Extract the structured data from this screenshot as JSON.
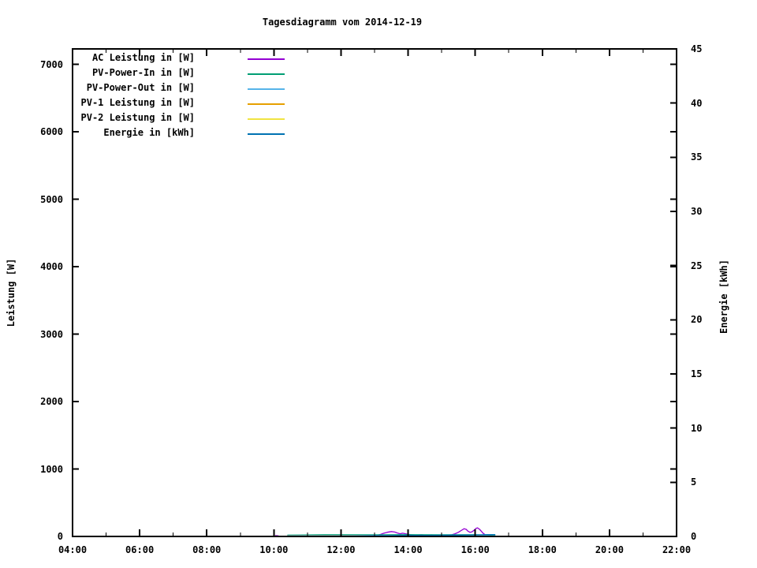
{
  "page": {
    "background": "#ffffff",
    "text_color": "#000000"
  },
  "chart_data": {
    "type": "line",
    "title": "Tagesdiagramm vom 2014-12-19",
    "xlabel": "",
    "ylabel": "Leistung [W]",
    "y2label": "Energie [kWh]",
    "x_range_hours": [
      4,
      22
    ],
    "ylim": [
      0,
      7230
    ],
    "y2lim": [
      0,
      45
    ],
    "grid": false,
    "legend_position": "top-left-inside",
    "x_major_ticks": [
      {
        "hour": 4,
        "label": "04:00"
      },
      {
        "hour": 6,
        "label": "06:00"
      },
      {
        "hour": 8,
        "label": "08:00"
      },
      {
        "hour": 10,
        "label": "10:00"
      },
      {
        "hour": 12,
        "label": "12:00"
      },
      {
        "hour": 14,
        "label": "14:00"
      },
      {
        "hour": 16,
        "label": "16:00"
      },
      {
        "hour": 18,
        "label": "18:00"
      },
      {
        "hour": 20,
        "label": "20:00"
      },
      {
        "hour": 22,
        "label": "22:00"
      }
    ],
    "x_minor_hours": [
      5,
      7,
      9,
      11,
      13,
      15,
      17,
      19,
      21
    ],
    "y_ticks": [
      0,
      1000,
      2000,
      3000,
      4000,
      5000,
      6000,
      7000
    ],
    "y2_ticks": [
      0,
      5,
      10,
      15,
      20,
      25,
      30,
      35,
      40,
      45
    ],
    "series": [
      {
        "name": "AC Leistung in [W]",
        "color": "#9400D3",
        "axis": "y1",
        "segments": [
          [
            [
              10.04,
              13
            ],
            [
              10.14,
              8
            ]
          ],
          [
            [
              10.4,
              10
            ],
            [
              10.55,
              16
            ],
            [
              10.75,
              13
            ],
            [
              10.95,
              16
            ],
            [
              11.15,
              13
            ],
            [
              11.35,
              16
            ],
            [
              11.6,
              13
            ],
            [
              11.85,
              15
            ],
            [
              12.1,
              13
            ],
            [
              12.35,
              16
            ],
            [
              12.6,
              13
            ],
            [
              12.8,
              15
            ],
            [
              12.95,
              13
            ],
            [
              13.08,
              18
            ],
            [
              13.18,
              30
            ],
            [
              13.28,
              48
            ],
            [
              13.38,
              62
            ],
            [
              13.5,
              72
            ],
            [
              13.6,
              65
            ],
            [
              13.68,
              52
            ],
            [
              13.76,
              40
            ],
            [
              13.84,
              48
            ],
            [
              13.92,
              40
            ],
            [
              14.0,
              30
            ],
            [
              14.1,
              24
            ],
            [
              14.25,
              20
            ],
            [
              14.4,
              24
            ],
            [
              14.55,
              19
            ],
            [
              14.7,
              23
            ],
            [
              14.85,
              18
            ],
            [
              15.0,
              21
            ],
            [
              15.1,
              18
            ],
            [
              15.2,
              20
            ],
            [
              15.3,
              24
            ],
            [
              15.4,
              40
            ],
            [
              15.5,
              62
            ],
            [
              15.58,
              88
            ],
            [
              15.67,
              115
            ],
            [
              15.73,
              105
            ],
            [
              15.78,
              80
            ],
            [
              15.84,
              62
            ],
            [
              15.9,
              68
            ],
            [
              15.96,
              90
            ],
            [
              16.02,
              118
            ],
            [
              16.07,
              127
            ],
            [
              16.13,
              105
            ],
            [
              16.18,
              78
            ],
            [
              16.24,
              45
            ],
            [
              16.3,
              24
            ],
            [
              16.4,
              13
            ],
            [
              16.5,
              7
            ],
            [
              16.58,
              4
            ]
          ]
        ]
      },
      {
        "name": "PV-Power-In in [W]",
        "color": "#009E73",
        "axis": "y1",
        "segments": [
          [
            [
              10.4,
              20
            ],
            [
              11.5,
              26
            ],
            [
              13.0,
              24
            ],
            [
              14.0,
              26
            ],
            [
              15.0,
              24
            ],
            [
              16.0,
              26
            ],
            [
              16.45,
              18
            ],
            [
              16.6,
              8
            ]
          ]
        ]
      },
      {
        "name": "PV-Power-Out in [W]",
        "color": "#56B4E9",
        "axis": "y1",
        "segments": [
          [
            [
              10.4,
              13
            ],
            [
              12.0,
              16
            ],
            [
              14.0,
              15
            ],
            [
              16.0,
              16
            ],
            [
              16.6,
              6
            ]
          ]
        ]
      },
      {
        "name": "PV-1 Leistung in [W]",
        "color": "#E69F00",
        "axis": "y1",
        "segments": [
          [
            [
              10.4,
              6
            ],
            [
              13.5,
              7
            ],
            [
              16.6,
              5
            ]
          ]
        ]
      },
      {
        "name": "PV-2 Leistung in [W]",
        "color": "#F0E442",
        "axis": "y1",
        "segments": [
          [
            [
              10.4,
              6
            ],
            [
              13.5,
              7
            ],
            [
              16.6,
              5
            ]
          ]
        ]
      },
      {
        "name": "Energie in [kWh]",
        "color": "#0072B2",
        "axis": "y2",
        "segments": [
          [
            [
              10.4,
              0.005
            ],
            [
              11.0,
              0.015
            ],
            [
              11.7,
              0.025
            ],
            [
              12.4,
              0.04
            ],
            [
              13.0,
              0.055
            ],
            [
              13.45,
              0.07
            ],
            [
              13.75,
              0.085
            ],
            [
              14.1,
              0.095
            ],
            [
              14.6,
              0.105
            ],
            [
              15.1,
              0.115
            ],
            [
              15.55,
              0.125
            ],
            [
              15.9,
              0.14
            ],
            [
              16.15,
              0.155
            ],
            [
              16.35,
              0.165
            ],
            [
              16.6,
              0.17
            ]
          ]
        ]
      }
    ]
  }
}
